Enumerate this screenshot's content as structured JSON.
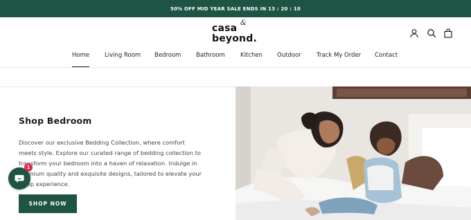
{
  "announcement": {
    "text": "50% OFF MID YEAR SALE ENDS IN 13 : 20 : 10"
  },
  "brand": {
    "line1": "casa",
    "amp": "&",
    "line2": "beyond."
  },
  "header_icons": [
    "account-icon",
    "search-icon",
    "shopping-bag-icon"
  ],
  "nav": {
    "items": [
      {
        "label": "Home",
        "active": true
      },
      {
        "label": "Living Room"
      },
      {
        "label": "Bedroom"
      },
      {
        "label": "Bathroom"
      },
      {
        "label": "Kitchen"
      },
      {
        "label": "Outdoor"
      },
      {
        "label": "Track My Order"
      },
      {
        "label": "Contact"
      }
    ]
  },
  "hero": {
    "title": "Shop Bedroom",
    "description": "Discover our exclusive Bedding Collection, where comfort meets style. Explore our curated range of bedding collection to transform your bedroom into a haven of relaxation. Indulge in premium quality and exquisite designs, tailored to elevate your sleep experience.",
    "button_label": "SHOP NOW"
  },
  "chat_widget": {
    "badge_count": "1",
    "icon": "chat-bubble-icon"
  },
  "colors": {
    "brand_green": "#1d5443",
    "badge_red": "#e0274a"
  }
}
